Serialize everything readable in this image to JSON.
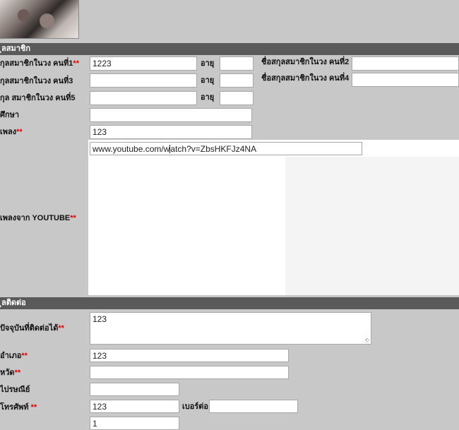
{
  "members_section": {
    "title": "ุลสมาชิก",
    "member1_label": "กุลสมาชิกในวง คนที่1",
    "member1_value": "1223",
    "member2_label": "ชื่อสกุลสมาชิกในวง คนที่2",
    "member2_value": "",
    "member3_label": "กุลสมาชิกในวง คนที่3",
    "member3_value": "",
    "member4_label": "ชื่อสกุลสมาชิกในวง คนที่4",
    "member4_value": "",
    "member5_label": "กุล สมาชิกในวง คนที่5",
    "member5_value": "",
    "age_label": "อายุ",
    "age1_value": "",
    "age3_value": "",
    "age5_value": "",
    "school_label": "ศึกษา",
    "school_value": "",
    "song_label": "เพลง",
    "song_value": "123",
    "youtube_label": "เพลงจาก YOUTUBE",
    "youtube_url_before": "www.youtube.com/w",
    "youtube_url_after": "atch?v=ZbsHKFJz4NA",
    "required_mark": "**"
  },
  "contact_section": {
    "title": "ุลติดต่อ",
    "address_label": "ปัจจุบันที่ติดต่อได้",
    "address_value": "123",
    "district_label": "อำเภอ",
    "district_value": "123",
    "province_label": "หวัด",
    "province_value": "",
    "postcode_label": "ไปรษณีย์",
    "postcode_value": "",
    "phone_label": "โทรศัพท์",
    "phone_value": "123",
    "ext_label": "เบอร์ต่อ",
    "ext_value": "",
    "extra_value": "1"
  }
}
